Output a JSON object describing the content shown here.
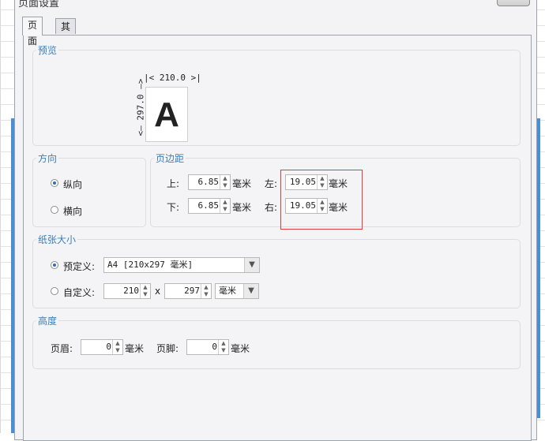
{
  "dialog": {
    "title": "页面设置"
  },
  "tabs": [
    {
      "label": "页面"
    },
    {
      "label": "其他"
    }
  ],
  "preview": {
    "title": "预览",
    "width_label": "210.0",
    "height_label": "297.0",
    "letter": "A"
  },
  "orientation": {
    "title": "方向",
    "portrait": "纵向",
    "landscape": "横向",
    "selected": "纵向"
  },
  "margins": {
    "title": "页边距",
    "top_label": "上:",
    "top_value": "6.85",
    "bottom_label": "下:",
    "bottom_value": "6.85",
    "left_label": "左:",
    "left_value": "19.05",
    "right_label": "右:",
    "right_value": "19.05",
    "unit": "毫米"
  },
  "paper": {
    "title": "纸张大小",
    "predefined_label": "预定义:",
    "predefined_value": "A4 [210x297 毫米]",
    "custom_label": "自定义:",
    "custom_width": "210",
    "times": "x",
    "custom_height": "297",
    "custom_unit": "毫米"
  },
  "height": {
    "title": "高度",
    "header_label": "页眉:",
    "header_value": "0",
    "footer_label": "页脚:",
    "footer_value": "0",
    "unit": "毫米"
  },
  "colors": {
    "accent": "#3a7fb8",
    "highlight": "#e23b3b"
  }
}
